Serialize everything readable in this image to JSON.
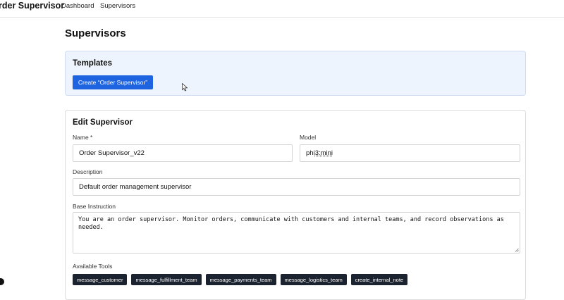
{
  "app": {
    "brand": "rder Supervisor",
    "nav": [
      {
        "label": "Dashboard"
      },
      {
        "label": "Supervisors"
      }
    ]
  },
  "page": {
    "title": "Supervisors"
  },
  "templates": {
    "heading": "Templates",
    "create_button": "Create “Order Supervisor”"
  },
  "edit": {
    "heading": "Edit Supervisor",
    "name_label": "Name *",
    "name_value": "Order Supervisor_v22",
    "model_label": "Model",
    "model_value_prefix": "phi",
    "model_value_rest": "3:mini",
    "description_label": "Description",
    "description_value": "Default order management supervisor",
    "instruction_label": "Base Instruction",
    "instruction_value": "You are an order supervisor. Monitor orders, communicate with customers and internal teams, and record observations as needed.",
    "tools_label": "Available Tools",
    "tools": [
      {
        "label": "message_customer"
      },
      {
        "label": "message_fulfillment_team"
      },
      {
        "label": "message_payments_team"
      },
      {
        "label": "message_logistics_team"
      },
      {
        "label": "create_internal_note"
      }
    ]
  },
  "colors": {
    "primary": "#1e63e0",
    "templates_bg": "#eef4fd",
    "chip_bg": "#1b2230"
  },
  "icons": {
    "cursor": "mouse-pointer-icon",
    "resize": "resize-grip-icon"
  }
}
